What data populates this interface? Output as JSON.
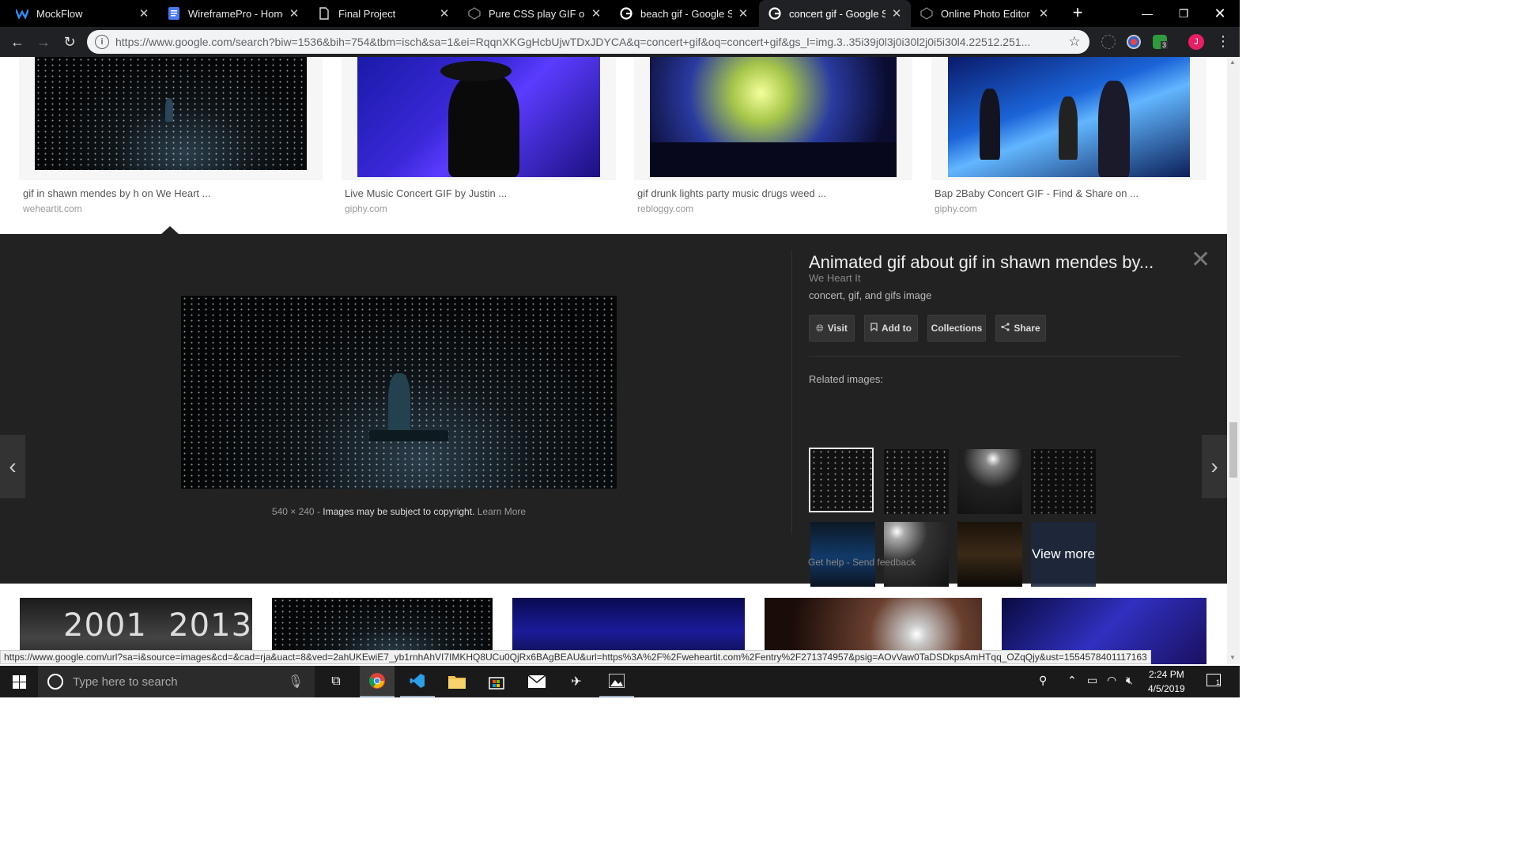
{
  "browser": {
    "tabs": [
      {
        "title": "MockFlow",
        "icon": "mockflow-icon"
      },
      {
        "title": "WireframePro - Home /",
        "icon": "document-icon"
      },
      {
        "title": "Final Project",
        "icon": "page-icon"
      },
      {
        "title": "Pure CSS play GIF on h",
        "icon": "codepen-icon"
      },
      {
        "title": "beach gif - Google Sea",
        "icon": "google-icon"
      },
      {
        "title": "concert gif - Google Se",
        "icon": "google-icon",
        "active": true
      },
      {
        "title": "Online Photo Editor | P",
        "icon": "codepen-icon"
      }
    ],
    "url": "https://www.google.com/search?biw=1536&bih=754&tbm=isch&sa=1&ei=RqqnXKGgHcbUjwTDxJDYCA&q=concert+gif&oq=concert+gif&gs_l=img.3..35i39j0l3j0i30l2j0i5i30l4.22512.251...",
    "profile_initial": "J",
    "ext_badge": "3"
  },
  "results_top": [
    {
      "title": "gif in shawn mendes by h on We Heart ...",
      "source": "weheartit.com"
    },
    {
      "title": "Live Music Concert GIF by Justin ...",
      "source": "giphy.com"
    },
    {
      "title": "gif drunk lights party music drugs weed ...",
      "source": "rebloggy.com"
    },
    {
      "title": "Bap 2Baby Concert GIF - Find & Share on ...",
      "source": "giphy.com"
    }
  ],
  "preview": {
    "title": "Animated gif about gif in shawn mendes by...",
    "source": "We Heart It",
    "description": "concert, gif, and gifs image",
    "dimensions": "540 × 240",
    "copyright": "Images may be subject to copyright.",
    "learn_more": "Learn More",
    "buttons": {
      "visit": "Visit",
      "add_to": "Add to",
      "collections": "Collections",
      "share": "Share"
    },
    "related_label": "Related images:",
    "view_more": "View more",
    "get_help": "Get help",
    "send_feedback": "Send feedback"
  },
  "bottom_row": {
    "first_text": "2001  2013"
  },
  "status_url": "https://www.google.com/url?sa=i&source=images&cd=&cad=rja&uact=8&ved=2ahUKEwiE7_yb1rnhAhVI7IMKHQ8UCu0QjRx6BAgBEAU&url=https%3A%2F%2Fweheartit.com%2Fentry%2F271374957&psig=AOvVaw0TaDSDkpsAmHTqq_OZqQjy&ust=1554578401117163",
  "taskbar": {
    "search_placeholder": "Type here to search",
    "time": "2:24 PM",
    "date": "4/5/2019",
    "notifications": "1"
  }
}
